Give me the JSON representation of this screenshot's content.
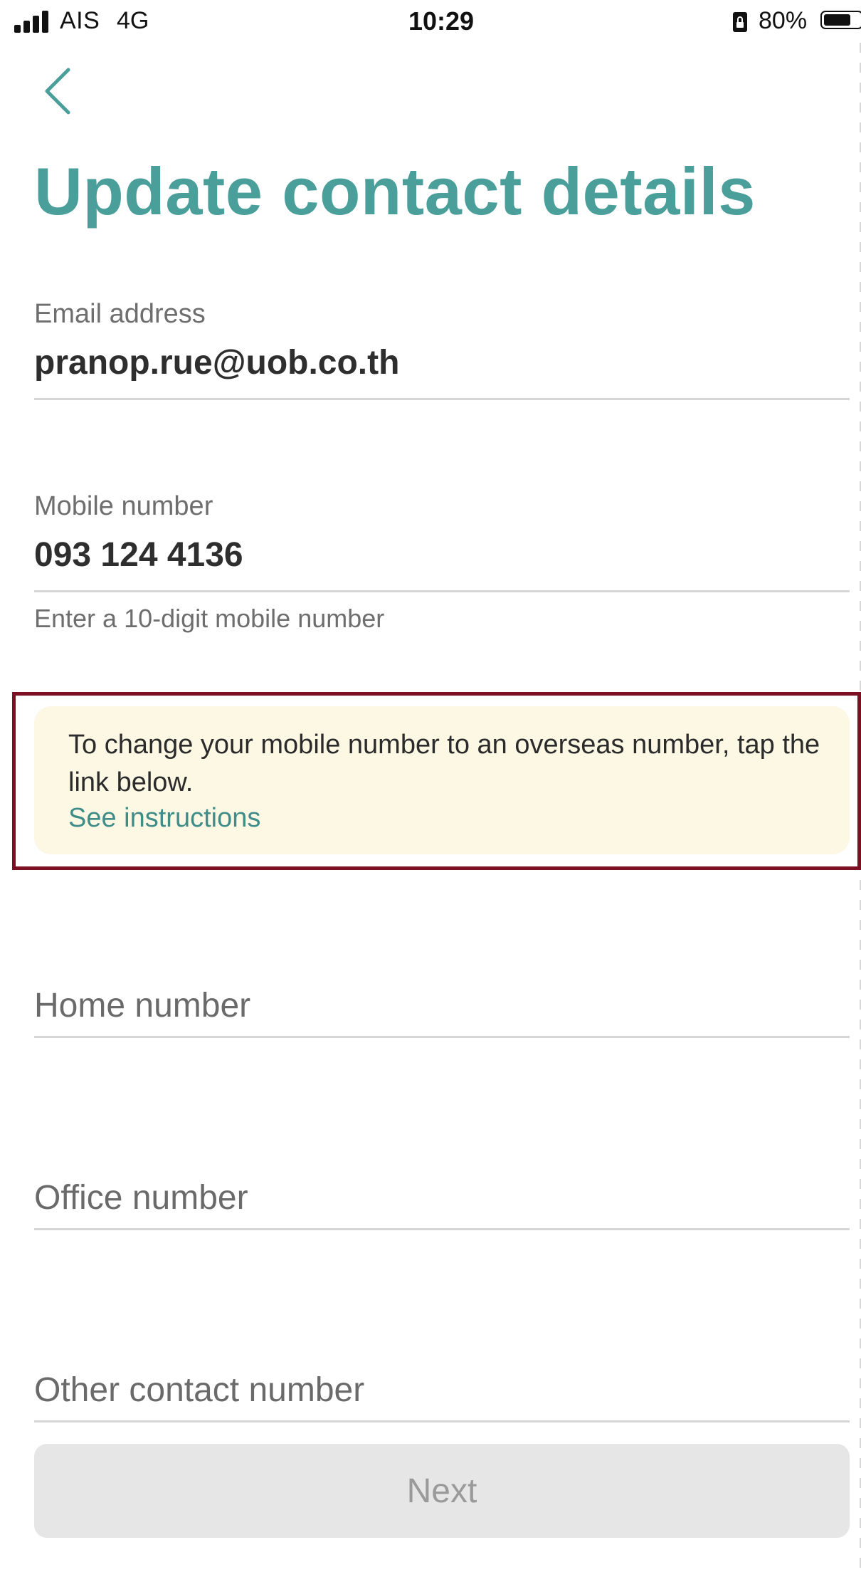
{
  "status_bar": {
    "carrier": "AIS",
    "network": "4G",
    "time": "10:29",
    "battery_percent": "80%",
    "battery_level": 0.8,
    "signal_icon": "signal-bars-icon",
    "lock_icon": "portrait-lock-icon",
    "battery_icon": "battery-icon"
  },
  "header": {
    "back_icon": "chevron-left-icon",
    "title": "Update contact details"
  },
  "form": {
    "email": {
      "label": "Email address",
      "value": "pranop.rue@uob.co.th"
    },
    "mobile": {
      "label": "Mobile number",
      "value": "093 124 4136",
      "hint": "Enter a 10-digit mobile number"
    },
    "notice": {
      "text": "To change your mobile number to an overseas number, tap the link below.",
      "link": "See instructions"
    },
    "home": {
      "placeholder": "Home number"
    },
    "office": {
      "placeholder": "Office number"
    },
    "other": {
      "placeholder": "Other contact number"
    }
  },
  "actions": {
    "next_label": "Next"
  },
  "colors": {
    "accent": "#4a9f9b",
    "link": "#3f8c88",
    "notice_bg": "#fcf8e4",
    "highlight_border": "#7d0f22",
    "button_disabled_bg": "#e6e6e6"
  }
}
